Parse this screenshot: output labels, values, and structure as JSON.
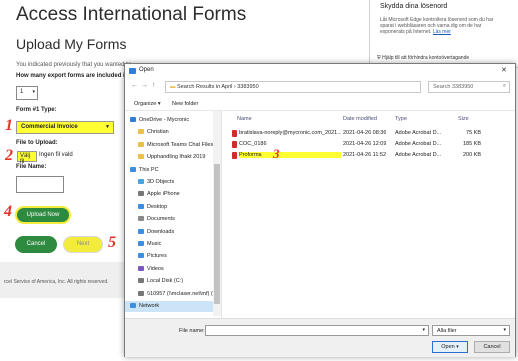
{
  "page": {
    "title": "Access International Forms",
    "subtitle": "Upload My Forms",
    "intro": "You indicated previously that you wanted to",
    "howmany_label": "How many export forms are included in",
    "count_value": "1",
    "form_type_label": "Form #1 Type:",
    "form_type_value": "Commercial Invoice",
    "file_label": "File to Upload:",
    "choose_file": "Välj fil",
    "no_file": "Ingen fil vald",
    "filename_label": "File Name:",
    "upload_button": "Upload Now",
    "cancel_button": "Cancel",
    "next_button": "Next",
    "footer": "rcel Service of America, Inc. All rights reserved."
  },
  "annotations": [
    "1",
    "2",
    "4",
    "5",
    "3"
  ],
  "edge_panel": {
    "title": "Skydda dina lösenord",
    "body": "Låt Microsoft Edge kontrollera lösenord som du har sparat i webbläsaren och varna dig om de har exponerats på Internet.",
    "link": "Läs mer",
    "help": "Hjälp till att förhindra kontoövertagande"
  },
  "dialog": {
    "title": "Open",
    "path": "Search Results in April  ›  3383950",
    "search_placeholder": "Search 3383950",
    "organize": "Organize ▾",
    "new_folder": "New folder",
    "tree": [
      {
        "label": "OneDrive - Mycronic",
        "icon": "cloud-icon",
        "color": "#2f7fd6"
      },
      {
        "label": "Christian",
        "icon": "folder-icon",
        "color": "#e8c04a"
      },
      {
        "label": "Microsoft Teams Chat Files",
        "icon": "folder-icon",
        "color": "#e8c04a"
      },
      {
        "label": "Upphandling Ifrakt 2019",
        "icon": "folder-icon",
        "color": "#e8c04a"
      },
      {
        "label": "This PC",
        "icon": "computer-icon",
        "color": "#3c8fe0"
      },
      {
        "label": "3D Objects",
        "icon": "cube-icon",
        "color": "#4aa3df"
      },
      {
        "label": "Apple iPhone",
        "icon": "phone-icon",
        "color": "#777777"
      },
      {
        "label": "Desktop",
        "icon": "desktop-icon",
        "color": "#3c8fe0"
      },
      {
        "label": "Documents",
        "icon": "documents-icon",
        "color": "#8a8a8a"
      },
      {
        "label": "Downloads",
        "icon": "download-icon",
        "color": "#3c8fe0"
      },
      {
        "label": "Music",
        "icon": "music-icon",
        "color": "#3c8fe0"
      },
      {
        "label": "Pictures",
        "icon": "pictures-icon",
        "color": "#3c8fe0"
      },
      {
        "label": "Videos",
        "icon": "videos-icon",
        "color": "#7a58c2"
      },
      {
        "label": "Local Disk (C:)",
        "icon": "disk-icon",
        "color": "#777777"
      },
      {
        "label": "\\\\10957 (\\\\mclaser.net\\mf) (\\user",
        "icon": "network-drive-icon",
        "color": "#777777"
      },
      {
        "label": "Network",
        "icon": "network-icon",
        "color": "#3c8fe0"
      }
    ],
    "columns": [
      "Name",
      "Date modified",
      "Type",
      "Size"
    ],
    "files": [
      {
        "name": "bratislava-noreply@mycronic.com_2021...",
        "date": "2021-04-26 08:36",
        "type": "Adobe Acrobat D...",
        "size": "75 KB"
      },
      {
        "name": "COC_0186",
        "date": "2021-04-26 12:09",
        "type": "Adobe Acrobat D...",
        "size": "185 KB"
      },
      {
        "name": "Proforma",
        "date": "2021-04-26 11:52",
        "type": "Adobe Acrobat D...",
        "size": "200 KB"
      }
    ],
    "filename_label": "File name:",
    "filter": "Alla filer",
    "open_button": "Open",
    "cancel_button": "Cancel"
  },
  "colors": {
    "highlight": "#ffff33",
    "annotation": "#e63228",
    "button_green": "#2e8a3f"
  }
}
